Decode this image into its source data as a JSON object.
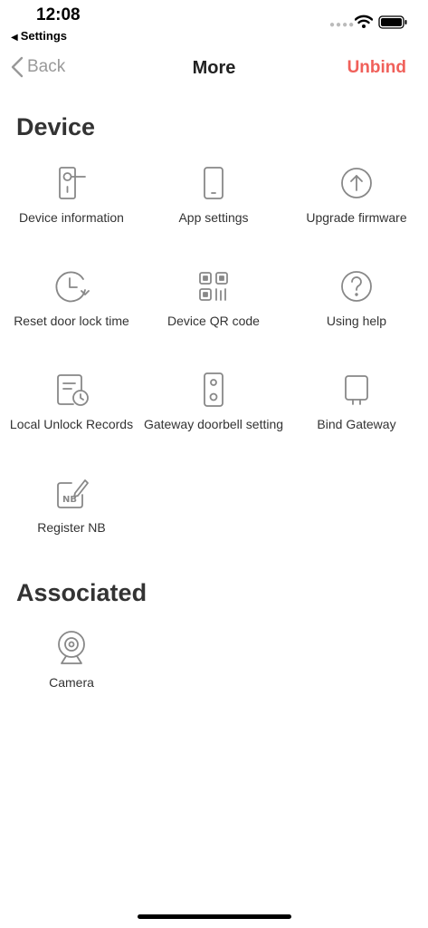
{
  "status_bar": {
    "time": "12:08",
    "back_label": "Settings"
  },
  "nav": {
    "back_label": "Back",
    "title": "More",
    "action_label": "Unbind",
    "action_color": "#f0605a"
  },
  "device": {
    "title": "Device",
    "items": [
      {
        "label": "Device information",
        "icon": "door-lock-icon"
      },
      {
        "label": "App settings",
        "icon": "phone-icon"
      },
      {
        "label": "Upgrade firmware",
        "icon": "upgrade-arrow-icon"
      },
      {
        "label": "Reset door lock time",
        "icon": "clock-reset-icon"
      },
      {
        "label": "Device QR code",
        "icon": "qr-code-icon"
      },
      {
        "label": "Using help",
        "icon": "help-icon"
      },
      {
        "label": "Local Unlock Records",
        "icon": "records-clock-icon"
      },
      {
        "label": "Gateway doorbell setting",
        "icon": "doorbell-icon"
      },
      {
        "label": "Bind Gateway",
        "icon": "gateway-icon"
      },
      {
        "label": "Register NB",
        "icon": "nb-register-icon"
      }
    ]
  },
  "associated": {
    "title": "Associated",
    "items": [
      {
        "label": "Camera",
        "icon": "camera-icon"
      }
    ]
  }
}
